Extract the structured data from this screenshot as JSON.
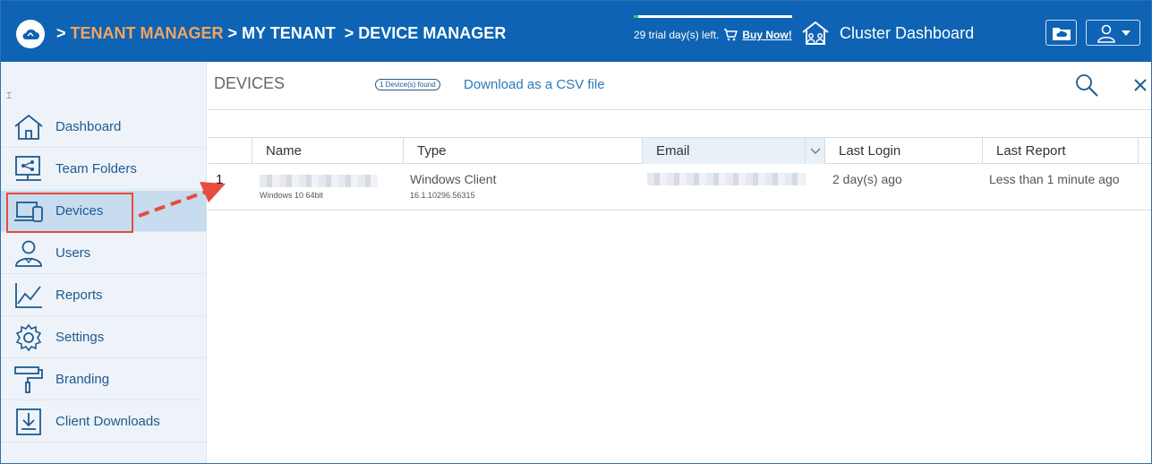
{
  "header": {
    "breadcrumb": [
      {
        "sep": ">",
        "label": "TENANT MANAGER"
      },
      {
        "sep": ">",
        "label": "MY TENANT"
      },
      {
        "sep": ">",
        "label": "DEVICE MANAGER"
      }
    ],
    "trial_text": "29 trial day(s) left.",
    "trial_progress": 0.03,
    "buy_label": "Buy Now!",
    "cluster_label": "Cluster Dashboard"
  },
  "sidebar": {
    "collapse_glyph": "⌶",
    "items": [
      {
        "label": "Dashboard",
        "icon": "home-icon"
      },
      {
        "label": "Team Folders",
        "icon": "share-folder-icon"
      },
      {
        "label": "Devices",
        "icon": "devices-icon",
        "active": true
      },
      {
        "label": "Users",
        "icon": "user-icon"
      },
      {
        "label": "Reports",
        "icon": "chart-icon"
      },
      {
        "label": "Settings",
        "icon": "gear-icon"
      },
      {
        "label": "Branding",
        "icon": "paint-roller-icon"
      },
      {
        "label": "Client Downloads",
        "icon": "download-icon"
      }
    ]
  },
  "main": {
    "title": "DEVICES",
    "found_badge": "1 Device(s) found",
    "csv_link": "Download as a CSV file",
    "columns": [
      "Name",
      "Type",
      "Email",
      "Last Login",
      "Last Report"
    ],
    "rows": [
      {
        "index": "1",
        "name_sub": "Windows 10 64bit",
        "type": "Windows Client",
        "type_sub": "16.1.10296.56315",
        "last_login": "2 day(s) ago",
        "last_report": "Less than 1 minute ago"
      }
    ]
  },
  "colors": {
    "header_bg": "#0e63b4",
    "accent_orange": "#f4a460",
    "highlight_red": "#e74c3c",
    "link_blue": "#2a7ab8"
  }
}
